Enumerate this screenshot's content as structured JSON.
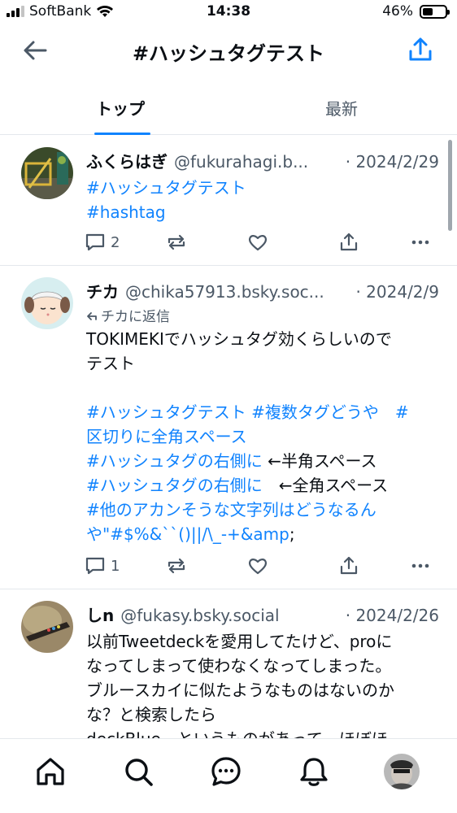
{
  "status_bar": {
    "carrier": "SoftBank",
    "time": "14:38",
    "battery_percent": "46%",
    "battery_level": 0.46
  },
  "header": {
    "title": "#ハッシュタグテスト",
    "back_icon": "arrow-left-icon",
    "share_icon": "share-upload-icon"
  },
  "tabs": [
    {
      "label": "トップ",
      "selected": true
    },
    {
      "label": "最新",
      "selected": false
    }
  ],
  "posts": [
    {
      "name": "ふくらはぎ",
      "handle": "@fukurahagi.b...",
      "date": "· 2024/2/29",
      "lines": [
        "#ハッシュタグテスト",
        "#hashtag"
      ],
      "reply_count": "2",
      "repost_count": "",
      "like_count": ""
    },
    {
      "name": "チカ",
      "handle": "@chika57913.bsky.soc...",
      "date": "· 2024/2/9",
      "reply_to": "チカに返信",
      "text_1": "TOKIMEKIでハッシュタグ効くらしいので",
      "text_2": "テスト",
      "tag_1": "#ハッシュタグテスト",
      "tag_2": "#複数タグどうや",
      "tag_3": "#",
      "tag_3b": "区切りに全角スペース",
      "tag_4": "#ハッシュタグの右側に",
      "note_4": "←半角スペース",
      "tag_5": "#ハッシュタグの右側に",
      "note_5": "←全角スペース",
      "tag_6": "#他のアカンそうな文字列はどうなるん",
      "tag_6b": "や\"#$%&``()||/\\_-+&amp",
      "tail_6": ";",
      "reply_count": "1"
    },
    {
      "name": "しn",
      "handle": "@fukasy.bsky.social",
      "date": "· 2024/2/26",
      "line_1": "以前Tweetdeckを愛用してたけど、proに",
      "line_2": "なってしまって使わなくなってしまった。",
      "line_3": "ブルースカイに似たようなものはないのか",
      "line_4": "な？と検索したら",
      "line_5": "deckBlue　というものがあって　ほぼほ"
    }
  ],
  "colors": {
    "accent": "#1083fe",
    "text": "#0b0f14",
    "muted": "#4b5866",
    "divider": "#e4e8ec"
  },
  "bottom_nav": [
    "home-icon",
    "search-icon",
    "chat-icon",
    "bell-icon",
    "profile-avatar"
  ]
}
